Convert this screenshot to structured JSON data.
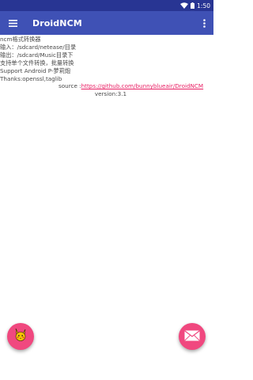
{
  "status_bar": {
    "time": "1:50",
    "icons": [
      "wifi-icon",
      "battery-icon"
    ]
  },
  "app_bar": {
    "title": "DroidNCM",
    "menu_icon": "menu-icon",
    "overflow_icon": "more-vert-icon"
  },
  "content": {
    "lines": [
      "ncm格式转换器",
      "输入：/sdcard/netease/目录",
      "输出：/sdcard/Music目录下",
      "支持单个文件转换，批量转换",
      "Support Android P-萝莉炮",
      "Thanks:openssl,taglib"
    ],
    "source_label": "source :",
    "source_link": "https://github.com/bunnyblueair/DroidNCM",
    "version": "version:3.1"
  },
  "fabs": {
    "left_icon": "pikachu-icon",
    "right_icon": "mail-icon"
  },
  "colors": {
    "status_bar": "#283593",
    "app_bar": "#3f51b5",
    "accent": "#f0487f",
    "link": "#e91e63"
  }
}
